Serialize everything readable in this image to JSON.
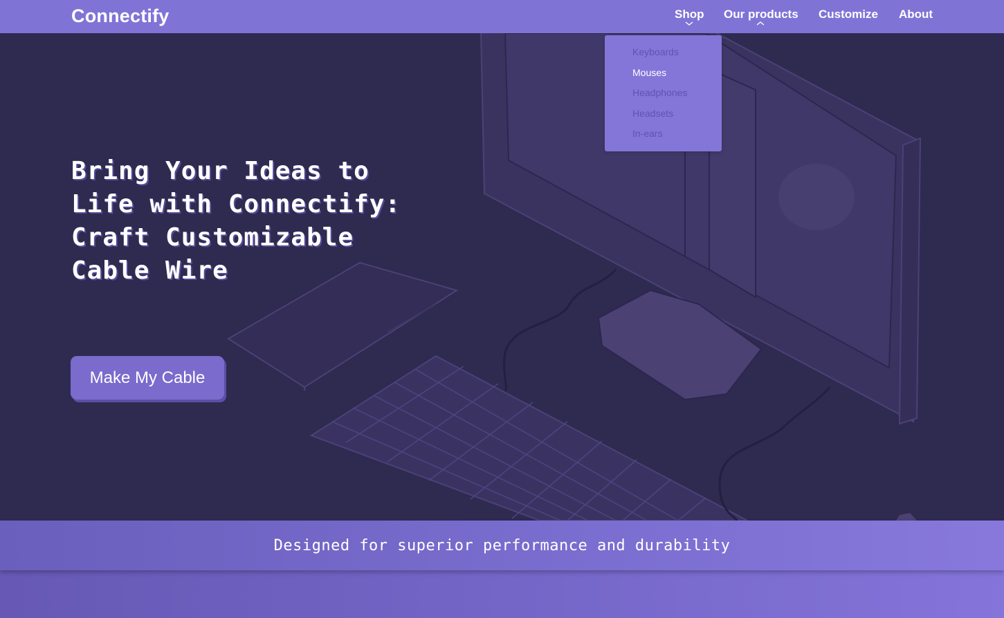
{
  "brand": {
    "name": "Connectify"
  },
  "nav": {
    "items": [
      {
        "label": "Shop"
      },
      {
        "label": "Our products"
      },
      {
        "label": "Customize"
      },
      {
        "label": "About"
      }
    ]
  },
  "dropdown": {
    "items": [
      {
        "label": "Keyboards",
        "active": false
      },
      {
        "label": "Mouses",
        "active": true
      },
      {
        "label": "Headphones",
        "active": false
      },
      {
        "label": "Headsets",
        "active": false
      },
      {
        "label": "In-ears",
        "active": false
      }
    ]
  },
  "hero": {
    "headline_lines": [
      "Bring Your Ideas to",
      "Life with Connectify:",
      "Craft Customizable",
      "Cable Wire"
    ],
    "cta_label": "Make My Cable"
  },
  "banner": {
    "text": "Designed for superior performance and durability"
  },
  "colors": {
    "nav_bg": "#7f74d6",
    "hero_bg": "#2f2a50",
    "accent": "#7a6bcc",
    "dropdown_bg": "#8475d9"
  },
  "icons": [
    "chevron-down-icon",
    "chevron-up-icon"
  ]
}
